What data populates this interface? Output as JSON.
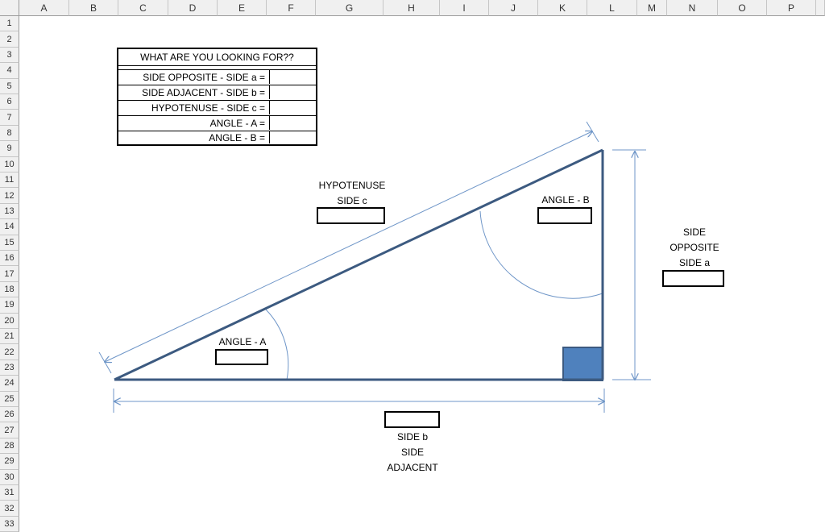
{
  "columns": [
    "A",
    "B",
    "C",
    "D",
    "E",
    "F",
    "G",
    "H",
    "I",
    "J",
    "K",
    "L",
    "M",
    "N",
    "O",
    "P"
  ],
  "rows": [
    "1",
    "2",
    "3",
    "4",
    "5",
    "6",
    "7",
    "8",
    "9",
    "10",
    "11",
    "12",
    "13",
    "14",
    "15",
    "16",
    "17",
    "18",
    "19",
    "20",
    "21",
    "22",
    "23",
    "24",
    "25",
    "26",
    "27",
    "28",
    "29",
    "30",
    "31",
    "32",
    "33"
  ],
  "lookup_table": {
    "title": "WHAT ARE YOU LOOKING FOR??",
    "items": [
      {
        "label": "SIDE OPPOSITE - SIDE a =",
        "value": ""
      },
      {
        "label": "SIDE ADJACENT - SIDE b =",
        "value": ""
      },
      {
        "label": "HYPOTENUSE - SIDE c =",
        "value": ""
      },
      {
        "label": "ANGLE - A =",
        "value": ""
      },
      {
        "label": "ANGLE - B =",
        "value": ""
      }
    ]
  },
  "diagram": {
    "hypotenuse_line1": "HYPOTENUSE",
    "hypotenuse_line2": "SIDE c",
    "angle_b": "ANGLE - B",
    "angle_a": "ANGLE - A",
    "opposite_line1": "SIDE",
    "opposite_line2": "OPPOSITE",
    "opposite_line3": "SIDE a",
    "adjacent_line1": "SIDE b",
    "adjacent_line2": "SIDE",
    "adjacent_line3": "ADJACENT"
  },
  "colors": {
    "triangle": "#3c5a80",
    "dimension": "#6f96c8",
    "right_angle_fill": "#4f81bd"
  }
}
